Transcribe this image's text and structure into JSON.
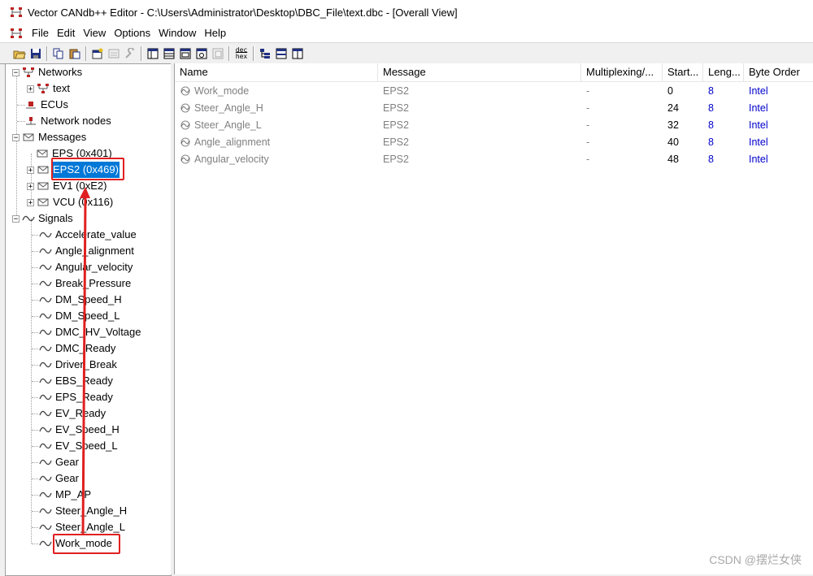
{
  "window": {
    "title": "Vector CANdb++ Editor - C:\\Users\\Administrator\\Desktop\\DBC_File\\text.dbc - [Overall View]"
  },
  "menu": [
    "File",
    "Edit",
    "View",
    "Options",
    "Window",
    "Help"
  ],
  "toolbar": {
    "buttons": [
      "open-icon",
      "save-icon",
      "copy-icon",
      "paste-icon",
      "properties-icon",
      "disabled-icon",
      "wrench-icon",
      "view1-icon",
      "view2-icon",
      "view3-icon",
      "view4-icon",
      "view5-icon",
      "dec-hex-icon",
      "tree-icon",
      "split-h-icon",
      "split-v-icon"
    ],
    "dec_hex_top": "dec",
    "dec_hex_bottom": "hex"
  },
  "tree": {
    "networks": "Networks",
    "network_child": "text",
    "ecus": "ECUs",
    "network_nodes": "Network nodes",
    "messages": "Messages",
    "message_items": [
      "EPS (0x401)",
      "EPS2 (0x469)",
      "EV1 (0xE2)",
      "VCU (0x116)"
    ],
    "signals": "Signals",
    "signal_items": [
      "Accelerate_value",
      "Angle_alignment",
      "Angular_velocity",
      "Break_Pressure",
      "DM_Speed_H",
      "DM_Speed_L",
      "DMC_HV_Voltage",
      "DMC_Ready",
      "Driver_Break",
      "EBS_Ready",
      "EPS_Ready",
      "EV_Ready",
      "EV_Speed_H",
      "EV_Speed_L",
      "Gear",
      "Gear",
      "MP_AP",
      "Steer_Angle_H",
      "Steer_Angle_L",
      "Work_mode"
    ]
  },
  "table": {
    "columns": [
      "Name",
      "Message",
      "Multiplexing/...",
      "Start...",
      "Leng...",
      "Byte Order"
    ],
    "rows": [
      {
        "name": "Work_mode",
        "message": "EPS2",
        "mux": "-",
        "start": "0",
        "length": "8",
        "order": "Intel"
      },
      {
        "name": "Steer_Angle_H",
        "message": "EPS2",
        "mux": "-",
        "start": "24",
        "length": "8",
        "order": "Intel"
      },
      {
        "name": "Steer_Angle_L",
        "message": "EPS2",
        "mux": "-",
        "start": "32",
        "length": "8",
        "order": "Intel"
      },
      {
        "name": "Angle_alignment",
        "message": "EPS2",
        "mux": "-",
        "start": "40",
        "length": "8",
        "order": "Intel"
      },
      {
        "name": "Angular_velocity",
        "message": "EPS2",
        "mux": "-",
        "start": "48",
        "length": "8",
        "order": "Intel"
      }
    ]
  },
  "watermark": "CSDN @摆烂女侠",
  "colors": {
    "selection": "#0078d7",
    "annotation": "#e02020",
    "link_blue": "#0000cc",
    "gray_text": "#808080"
  }
}
